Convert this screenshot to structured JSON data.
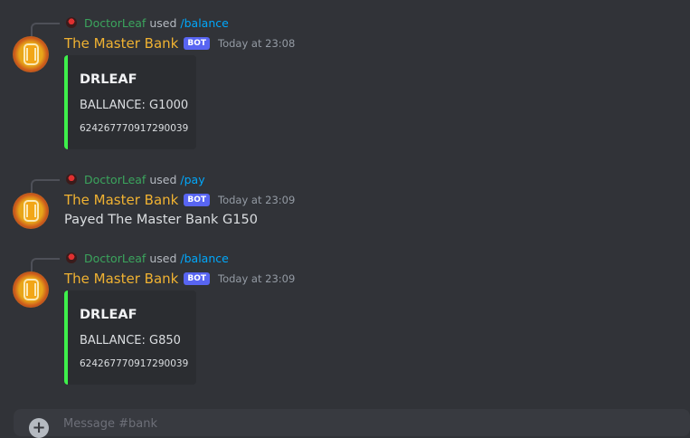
{
  "messages": [
    {
      "reply": {
        "user": "DoctorLeaf",
        "used": "used",
        "command": "/balance"
      },
      "author": "The Master Bank",
      "bot_tag": "BOT",
      "time": "Today at 23:08",
      "embed": {
        "title": "DRLEAF",
        "description": "BALLANCE: G1000",
        "footer": "624267770917290039",
        "color": "#3ef04b"
      }
    },
    {
      "reply": {
        "user": "DoctorLeaf",
        "used": "used",
        "command": "/pay"
      },
      "author": "The Master Bank",
      "bot_tag": "BOT",
      "time": "Today at 23:09",
      "content": "Payed The Master Bank G150"
    },
    {
      "reply": {
        "user": "DoctorLeaf",
        "used": "used",
        "command": "/balance"
      },
      "author": "The Master Bank",
      "bot_tag": "BOT",
      "time": "Today at 23:09",
      "embed": {
        "title": "DRLEAF",
        "description": "BALLANCE: G850",
        "footer": "624267770917290039",
        "color": "#3ef04b"
      }
    }
  ],
  "composer": {
    "placeholder": "Message #bank",
    "icon": "plus-circle-icon"
  },
  "colors": {
    "background": "#313338",
    "author": "#f0b232",
    "reply_user": "#3ba55d",
    "command": "#00a8fc",
    "bot_tag": "#5865f2"
  }
}
